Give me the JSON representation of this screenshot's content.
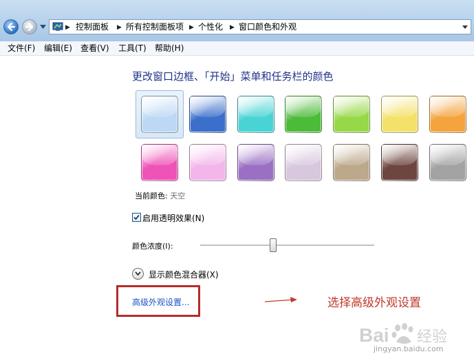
{
  "breadcrumbs": [
    "控制面板",
    "所有控制面板项",
    "个性化",
    "窗口颜色和外观"
  ],
  "menu": [
    "文件(F)",
    "编辑(E)",
    "查看(V)",
    "工具(T)",
    "帮助(H)"
  ],
  "section_title": "更改窗口边框、「开始」菜单和任务栏的颜色",
  "swatches": [
    {
      "name": "sky",
      "color": "#bcd8f5"
    },
    {
      "name": "twilight",
      "color": "#3b6fcb"
    },
    {
      "name": "sea-foam",
      "color": "#49d3d4"
    },
    {
      "name": "leaf",
      "color": "#4dbb3a"
    },
    {
      "name": "lime",
      "color": "#97d848"
    },
    {
      "name": "lemon",
      "color": "#f3e16a"
    },
    {
      "name": "pumpkin",
      "color": "#f4a33d"
    },
    {
      "name": "fuchsia",
      "color": "#ef53b8"
    },
    {
      "name": "blush",
      "color": "#f3b6ea"
    },
    {
      "name": "violet",
      "color": "#9a6fc4"
    },
    {
      "name": "lavender",
      "color": "#d7c8de"
    },
    {
      "name": "taupe",
      "color": "#bca88a"
    },
    {
      "name": "chocolate",
      "color": "#6e4640"
    },
    {
      "name": "slate",
      "color": "#a3a3a3"
    }
  ],
  "current_color": {
    "label": "当前颜色:",
    "value": "天空"
  },
  "transparency": {
    "label": "启用透明效果(N)",
    "checked": true
  },
  "intensity": {
    "label": "颜色浓度(I):",
    "value_fraction": 0.42
  },
  "mixer_label": "显示颜色混合器(X)",
  "advanced_link": "高级外观设置...",
  "annotation": "选择高级外观设置",
  "watermark": {
    "brand": "Bai经验",
    "sub": "jingyan.baidu.com"
  },
  "colors": {
    "title": "#1e3287",
    "link": "#1a52c6",
    "annotation": "#c0392b"
  }
}
